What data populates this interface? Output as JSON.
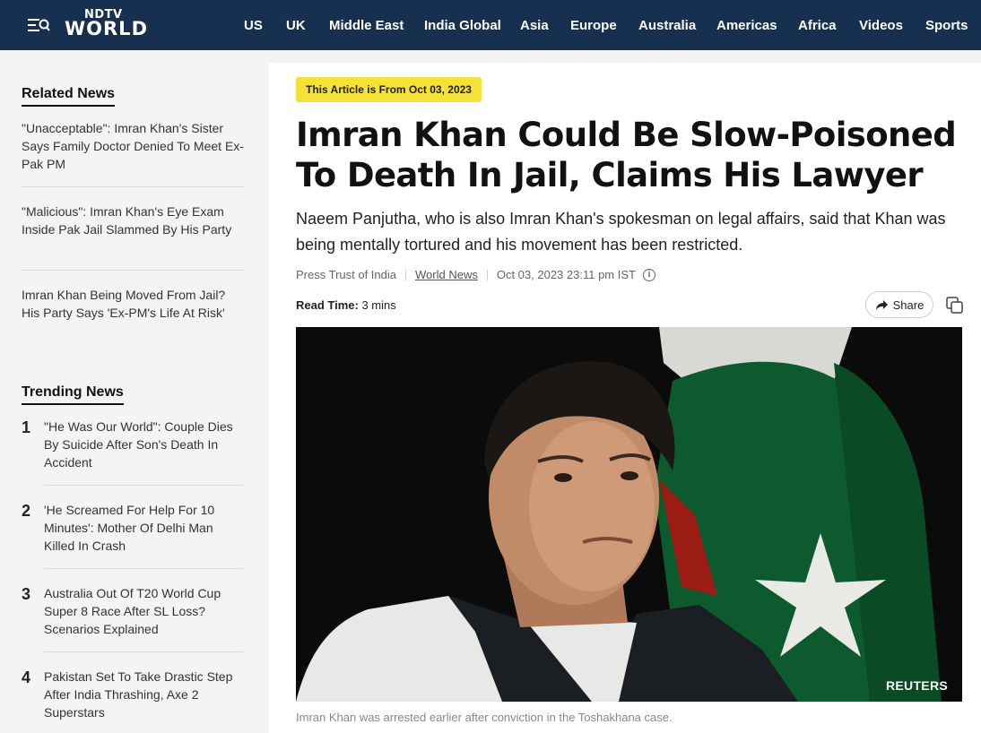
{
  "brand": {
    "logo_top": "NDTV",
    "logo_bottom": "WORLD"
  },
  "nav": [
    "US",
    "UK",
    "Middle East",
    "India Global",
    "Asia",
    "Europe",
    "Australia",
    "Americas",
    "Africa",
    "Videos",
    "Sports"
  ],
  "related": {
    "title": "Related News",
    "items": [
      "\"Unacceptable\": Imran Khan's Sister Says Family Doctor Denied To Meet Ex-Pak PM",
      "\"Malicious\": Imran Khan's Eye Exam Inside Pak Jail Slammed By His Party",
      "Imran Khan Being Moved From Jail? His Party Says 'Ex-PM's Life At Risk'"
    ]
  },
  "trending": {
    "title": "Trending News",
    "items": [
      {
        "num": "1",
        "text": "\"He Was Our World\": Couple Dies By Suicide After Son's Death In Accident"
      },
      {
        "num": "2",
        "text": "'He Screamed For Help For 10 Minutes': Mother Of Delhi Man Killed In Crash"
      },
      {
        "num": "3",
        "text": "Australia Out Of T20 World Cup Super 8 Race After SL Loss? Scenarios Explained"
      },
      {
        "num": "4",
        "text": "Pakistan Set To Take Drastic Step After India Thrashing, Axe 2 Superstars"
      }
    ]
  },
  "article": {
    "badge": "This Article is From Oct 03, 2023",
    "headline": "Imran Khan Could Be Slow-Poisoned To Death In Jail, Claims His Lawyer",
    "standfirst": "Naeem Panjutha, who is also Imran Khan's spokesman on legal affairs, said that Khan was being mentally tortured and his movement has been restricted.",
    "source": "Press Trust of India",
    "category": "World News",
    "datetime": "Oct 03, 2023 23:11 pm IST",
    "read_label": "Read Time:",
    "read_value": "3 mins",
    "share_label": "Share",
    "photo_credit": "REUTERS",
    "caption": "Imran Khan was arrested earlier after conviction in the Toshakhana case."
  },
  "colors": {
    "header_bg": "#17304f",
    "badge_bg": "#f5e13a",
    "flag_green": "#0d5a2e"
  },
  "icons": {
    "menu": "menu-search-icon",
    "share": "share-arrow-icon",
    "copy": "copy-icon",
    "info": "info-icon"
  }
}
